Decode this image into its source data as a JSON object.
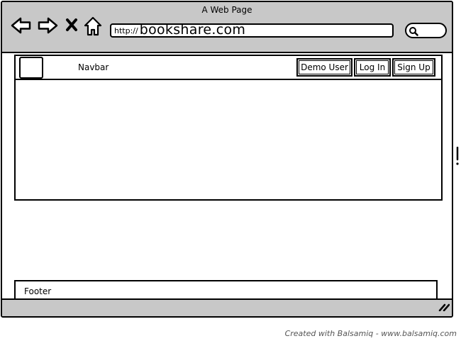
{
  "window": {
    "title": "A Web Page"
  },
  "address_bar": {
    "protocol": "http://",
    "domain": "bookshare.com"
  },
  "navbar": {
    "label": "Navbar",
    "buttons": {
      "demo_user": "Demo User",
      "log_in": "Log In",
      "sign_up": "Sign Up"
    }
  },
  "footer": {
    "label": "Footer"
  },
  "credit": "Created with Balsamiq - www.balsamiq.com",
  "icons": [
    "back-arrow-icon",
    "forward-arrow-icon",
    "close-icon",
    "home-icon",
    "search-icon",
    "resize-grip-icon"
  ],
  "colors": {
    "chrome": "#c8c8c8",
    "border": "#000000",
    "credit_text": "#555555"
  }
}
